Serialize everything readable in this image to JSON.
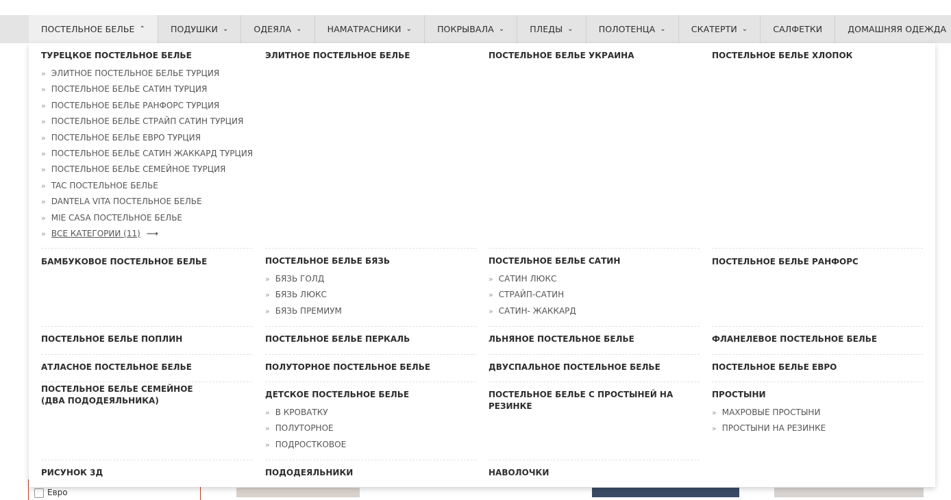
{
  "nav": {
    "items": [
      {
        "label": "ПОСТЕЛЬНОЕ БЕЛЬЕ",
        "chevron": "⌃"
      },
      {
        "label": "ПОДУШКИ",
        "chevron": "⌄"
      },
      {
        "label": "ОДЕЯЛА",
        "chevron": "⌄"
      },
      {
        "label": "НАМАТРАСНИКИ",
        "chevron": "⌄"
      },
      {
        "label": "ПОКРЫВАЛА",
        "chevron": "⌄"
      },
      {
        "label": "ПЛЕДЫ",
        "chevron": "⌄"
      },
      {
        "label": "ПОЛОТЕНЦА",
        "chevron": "⌄"
      },
      {
        "label": "СКАТЕРТИ",
        "chevron": "⌄"
      },
      {
        "label": "САЛФЕТКИ",
        "chevron": ""
      },
      {
        "label": "ДОМАШНЯЯ ОДЕЖДА",
        "chevron": "⌄"
      }
    ]
  },
  "menu": {
    "row1": {
      "turkish": {
        "title": "ТУРЕЦКОЕ ПОСТЕЛЬНОЕ БЕЛЬЕ",
        "items": [
          "ЭЛИТНОЕ ПОСТЕЛЬНОЕ БЕЛЬЕ ТУРЦИЯ",
          "ПОСТЕЛЬНОЕ БЕЛЬЕ САТИН ТУРЦИЯ",
          "ПОСТЕЛЬНОЕ БЕЛЬЕ РАНФОРС ТУРЦИЯ",
          "ПОСТЕЛЬНОЕ БЕЛЬЕ СТРАЙП САТИН ТУРЦИЯ",
          "ПОСТЕЛЬНОЕ БЕЛЬЕ ЕВРО ТУРЦИЯ",
          "ПОСТЕЛЬНОЕ БЕЛЬЕ САТИН ЖАККАРД ТУРЦИЯ",
          "ПОСТЕЛЬНОЕ БЕЛЬЕ СЕМЕЙНОЕ ТУРЦИЯ",
          "TAC ПОСТЕЛЬНОЕ БЕЛЬЕ",
          "DANTELA VITA ПОСТЕЛЬНОЕ БЕЛЬЕ",
          "MIE CASA ПОСТЕЛЬНОЕ БЕЛЬЕ"
        ],
        "all_label": "ВСЕ КАТЕГОРИИ (11)",
        "all_arrow": "⟶"
      },
      "elite": {
        "title": "ЭЛИТНОЕ ПОСТЕЛЬНОЕ БЕЛЬЕ"
      },
      "ukraine": {
        "title": "ПОСТЕЛЬНОЕ БЕЛЬЕ УКРАИНА"
      },
      "cotton": {
        "title": "ПОСТЕЛЬНОЕ БЕЛЬЕ ХЛОПОК"
      }
    },
    "row2": {
      "bamboo": {
        "title": "БАМБУКОВОЕ ПОСТЕЛЬНОЕ БЕЛЬЕ"
      },
      "calico": {
        "title": "ПОСТЕЛЬНОЕ БЕЛЬЕ БЯЗЬ",
        "items": [
          "БЯЗЬ ГОЛД",
          "БЯЗЬ ЛЮКС",
          "БЯЗЬ ПРЕМИУМ"
        ]
      },
      "satin": {
        "title": "ПОСТЕЛЬНОЕ БЕЛЬЕ САТИН",
        "items": [
          "САТИН ЛЮКС",
          "СТРАЙП-САТИН",
          "САТИН- ЖАККАРД"
        ]
      },
      "ranforce": {
        "title": "ПОСТЕЛЬНОЕ БЕЛЬЕ РАНФОРС"
      }
    },
    "row3": {
      "poplin": {
        "title": "ПОСТЕЛЬНОЕ БЕЛЬЕ ПОПЛИН"
      },
      "percale": {
        "title": "ПОСТЕЛЬНОЕ БЕЛЬЕ ПЕРКАЛЬ"
      },
      "linen": {
        "title": "ЛЬНЯНОЕ ПОСТЕЛЬНОЕ БЕЛЬЕ"
      },
      "flannel": {
        "title": "ФЛАНЕЛЕВОЕ ПОСТЕЛЬНОЕ БЕЛЬЕ"
      }
    },
    "row4": {
      "atlas": {
        "title": "АТЛАСНОЕ ПОСТЕЛЬНОЕ БЕЛЬЕ"
      },
      "single": {
        "title": "ПОЛУТОРНОЕ ПОСТЕЛЬНОЕ БЕЛЬЕ"
      },
      "double": {
        "title": "ДВУСПАЛЬНОЕ ПОСТЕЛЬНОЕ БЕЛЬЕ"
      },
      "euro": {
        "title": "ПОСТЕЛЬНОЕ БЕЛЬЕ ЕВРО"
      }
    },
    "row5": {
      "family": {
        "title": "ПОСТЕЛЬНОЕ БЕЛЬЕ СЕМЕЙНОЕ (ДВА ПОДОДЕЯЛЬНИКА)"
      },
      "kids": {
        "title": "ДЕТСКОЕ ПОСТЕЛЬНОЕ БЕЛЬЕ",
        "items": [
          "В КРОВАТКУ",
          "ПОЛУТОРНОЕ",
          "ПОДРОСТКОВОЕ"
        ]
      },
      "elastic": {
        "title": "ПОСТЕЛЬНОЕ БЕЛЬЕ С ПРОСТЫНЕЙ НА РЕЗИНКЕ"
      },
      "sheets": {
        "title": "ПРОСТЫНИ",
        "items": [
          "МАХРОВЫЕ ПРОСТЫНИ",
          "ПРОСТЫНИ НА РЕЗИНКЕ"
        ]
      }
    },
    "row6": {
      "pattern3d": {
        "title": "РИСУНОК 3Д"
      },
      "duvet": {
        "title": "ПОДОДЕЯЛЬНИКИ"
      },
      "pillowcases": {
        "title": "НАВОЛОЧКИ"
      }
    },
    "raquo": "»"
  },
  "background": {
    "filter_label": "Евро"
  }
}
